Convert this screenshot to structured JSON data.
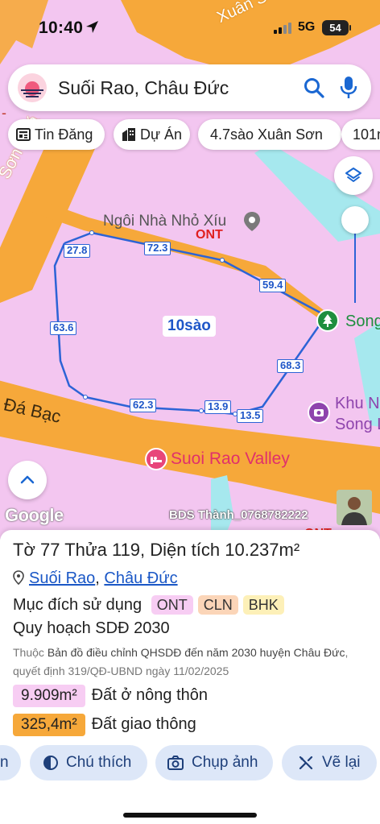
{
  "status": {
    "time": "10:40",
    "network": "5G",
    "battery": "54"
  },
  "search": {
    "query": "Suối Rao, Châu Đức"
  },
  "chips": [
    {
      "label": "Tin Đăng",
      "icon": "newspaper-icon"
    },
    {
      "label": "Dự Án",
      "icon": "building-icon"
    },
    {
      "label": "4.7sào Xuân Sơn",
      "icon": ""
    },
    {
      "label": "101m",
      "icon": ""
    }
  ],
  "map": {
    "road_labels": {
      "top_right": "Xuân S",
      "left": "Sơn - Đá",
      "da_bac": "Đá Bạc",
      "partial_left": "-"
    },
    "poi": {
      "house": "Ngôi Nhà Nhỏ Xíu",
      "song": "Song",
      "khu_line1": "Khu N",
      "khu_line2": "Song L",
      "valley": "Suoi Rao Valley"
    },
    "zone_labels": {
      "ont_1": "ONT",
      "ont_2": "ONT"
    },
    "segment_labels": [
      "27.8",
      "72.3",
      "59.4",
      "63.6",
      "68.3",
      "62.3",
      "13.9",
      "13.5"
    ],
    "area_label": "10sào",
    "attribution": "Google",
    "watermark": "BDS Thành_0768782222",
    "colors": {
      "land": "#f3c6f0",
      "road": "#f6a83a",
      "water": "#a6e8ee",
      "outline": "#2c63d6"
    }
  },
  "parcel": {
    "to_label": "Tờ",
    "to_value": "77",
    "thua_label": "Thửa",
    "thua_value": "119",
    "area_label": "Diện tích",
    "area_value": "10.237m²",
    "location": {
      "commune": "Suối Rao",
      "district": "Châu Đức"
    },
    "purpose_label": "Mục đích sử dụng",
    "purpose_tags": [
      {
        "code": "ONT",
        "color": "#f7cdf3"
      },
      {
        "code": "CLN",
        "color": "#fbd5b8"
      },
      {
        "code": "BHK",
        "color": "#fdf0b8"
      }
    ],
    "plan_title": "Quy hoạch SDĐ 2030",
    "plan_note": {
      "prefix": "Thuộc",
      "map_name": "Bản đồ điều chỉnh QHSDĐ đến năm 2030 huyện Châu Đức",
      "decision": ", quyết định 319/QĐ-UBND ngày 11/02/2025"
    },
    "usages": [
      {
        "area": "9.909m²",
        "label": "Đất ở nông thôn",
        "color": "#f7cdf3"
      },
      {
        "area": "325,4m²",
        "label": "Đất giao thông",
        "color": "#f6a83a"
      }
    ]
  },
  "actions": [
    {
      "label": "n",
      "icon": ""
    },
    {
      "label": "Chú thích",
      "icon": "legend-icon"
    },
    {
      "label": "Chụp ảnh",
      "icon": "camera-icon"
    },
    {
      "label": "Vẽ lại",
      "icon": "redraw-icon"
    }
  ]
}
